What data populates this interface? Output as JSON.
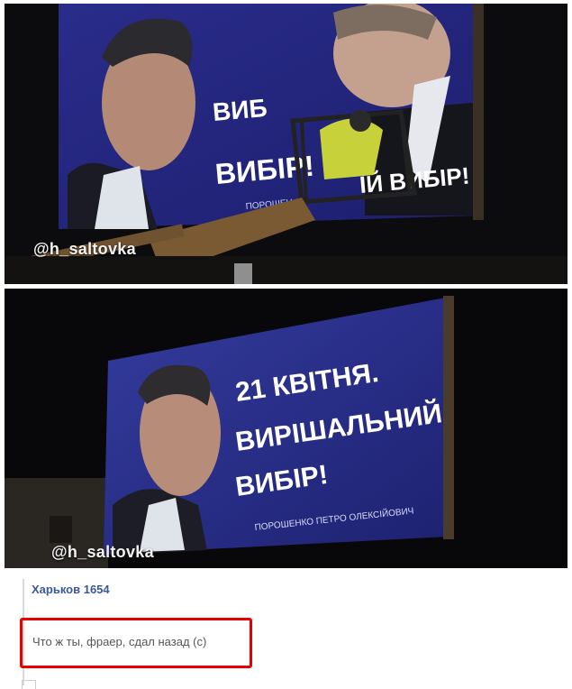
{
  "photo_top": {
    "watermark": "@h_saltovka",
    "billboard_lines": [
      "ВИБ",
      "ВИБІР!",
      "ІЙ ВИБІР!",
      "ПОРОШЕН"
    ]
  },
  "photo_bottom": {
    "watermark": "@h_saltovka",
    "billboard_lines": [
      "21 КВІТНЯ.",
      "ВИРІШАЛЬНИЙ",
      "ВИБІР!"
    ],
    "billboard_name": "ПОРОШЕНКО ПЕТРО ОЛЕКСІЙОВИЧ"
  },
  "comment": {
    "author": "Харьков 1654",
    "text": "Что ж ты, фраер, сдал назад (с)",
    "highlight_color": "#e60000"
  }
}
